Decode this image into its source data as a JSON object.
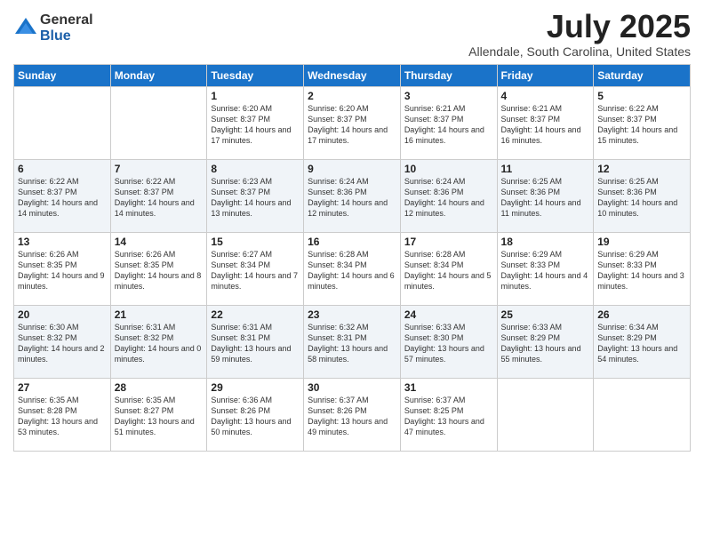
{
  "logo": {
    "general": "General",
    "blue": "Blue"
  },
  "title": "July 2025",
  "location": "Allendale, South Carolina, United States",
  "headers": [
    "Sunday",
    "Monday",
    "Tuesday",
    "Wednesday",
    "Thursday",
    "Friday",
    "Saturday"
  ],
  "weeks": [
    [
      {
        "day": "",
        "info": ""
      },
      {
        "day": "",
        "info": ""
      },
      {
        "day": "1",
        "info": "Sunrise: 6:20 AM\nSunset: 8:37 PM\nDaylight: 14 hours and 17 minutes."
      },
      {
        "day": "2",
        "info": "Sunrise: 6:20 AM\nSunset: 8:37 PM\nDaylight: 14 hours and 17 minutes."
      },
      {
        "day": "3",
        "info": "Sunrise: 6:21 AM\nSunset: 8:37 PM\nDaylight: 14 hours and 16 minutes."
      },
      {
        "day": "4",
        "info": "Sunrise: 6:21 AM\nSunset: 8:37 PM\nDaylight: 14 hours and 16 minutes."
      },
      {
        "day": "5",
        "info": "Sunrise: 6:22 AM\nSunset: 8:37 PM\nDaylight: 14 hours and 15 minutes."
      }
    ],
    [
      {
        "day": "6",
        "info": "Sunrise: 6:22 AM\nSunset: 8:37 PM\nDaylight: 14 hours and 14 minutes."
      },
      {
        "day": "7",
        "info": "Sunrise: 6:22 AM\nSunset: 8:37 PM\nDaylight: 14 hours and 14 minutes."
      },
      {
        "day": "8",
        "info": "Sunrise: 6:23 AM\nSunset: 8:37 PM\nDaylight: 14 hours and 13 minutes."
      },
      {
        "day": "9",
        "info": "Sunrise: 6:24 AM\nSunset: 8:36 PM\nDaylight: 14 hours and 12 minutes."
      },
      {
        "day": "10",
        "info": "Sunrise: 6:24 AM\nSunset: 8:36 PM\nDaylight: 14 hours and 12 minutes."
      },
      {
        "day": "11",
        "info": "Sunrise: 6:25 AM\nSunset: 8:36 PM\nDaylight: 14 hours and 11 minutes."
      },
      {
        "day": "12",
        "info": "Sunrise: 6:25 AM\nSunset: 8:36 PM\nDaylight: 14 hours and 10 minutes."
      }
    ],
    [
      {
        "day": "13",
        "info": "Sunrise: 6:26 AM\nSunset: 8:35 PM\nDaylight: 14 hours and 9 minutes."
      },
      {
        "day": "14",
        "info": "Sunrise: 6:26 AM\nSunset: 8:35 PM\nDaylight: 14 hours and 8 minutes."
      },
      {
        "day": "15",
        "info": "Sunrise: 6:27 AM\nSunset: 8:34 PM\nDaylight: 14 hours and 7 minutes."
      },
      {
        "day": "16",
        "info": "Sunrise: 6:28 AM\nSunset: 8:34 PM\nDaylight: 14 hours and 6 minutes."
      },
      {
        "day": "17",
        "info": "Sunrise: 6:28 AM\nSunset: 8:34 PM\nDaylight: 14 hours and 5 minutes."
      },
      {
        "day": "18",
        "info": "Sunrise: 6:29 AM\nSunset: 8:33 PM\nDaylight: 14 hours and 4 minutes."
      },
      {
        "day": "19",
        "info": "Sunrise: 6:29 AM\nSunset: 8:33 PM\nDaylight: 14 hours and 3 minutes."
      }
    ],
    [
      {
        "day": "20",
        "info": "Sunrise: 6:30 AM\nSunset: 8:32 PM\nDaylight: 14 hours and 2 minutes."
      },
      {
        "day": "21",
        "info": "Sunrise: 6:31 AM\nSunset: 8:32 PM\nDaylight: 14 hours and 0 minutes."
      },
      {
        "day": "22",
        "info": "Sunrise: 6:31 AM\nSunset: 8:31 PM\nDaylight: 13 hours and 59 minutes."
      },
      {
        "day": "23",
        "info": "Sunrise: 6:32 AM\nSunset: 8:31 PM\nDaylight: 13 hours and 58 minutes."
      },
      {
        "day": "24",
        "info": "Sunrise: 6:33 AM\nSunset: 8:30 PM\nDaylight: 13 hours and 57 minutes."
      },
      {
        "day": "25",
        "info": "Sunrise: 6:33 AM\nSunset: 8:29 PM\nDaylight: 13 hours and 55 minutes."
      },
      {
        "day": "26",
        "info": "Sunrise: 6:34 AM\nSunset: 8:29 PM\nDaylight: 13 hours and 54 minutes."
      }
    ],
    [
      {
        "day": "27",
        "info": "Sunrise: 6:35 AM\nSunset: 8:28 PM\nDaylight: 13 hours and 53 minutes."
      },
      {
        "day": "28",
        "info": "Sunrise: 6:35 AM\nSunset: 8:27 PM\nDaylight: 13 hours and 51 minutes."
      },
      {
        "day": "29",
        "info": "Sunrise: 6:36 AM\nSunset: 8:26 PM\nDaylight: 13 hours and 50 minutes."
      },
      {
        "day": "30",
        "info": "Sunrise: 6:37 AM\nSunset: 8:26 PM\nDaylight: 13 hours and 49 minutes."
      },
      {
        "day": "31",
        "info": "Sunrise: 6:37 AM\nSunset: 8:25 PM\nDaylight: 13 hours and 47 minutes."
      },
      {
        "day": "",
        "info": ""
      },
      {
        "day": "",
        "info": ""
      }
    ]
  ]
}
